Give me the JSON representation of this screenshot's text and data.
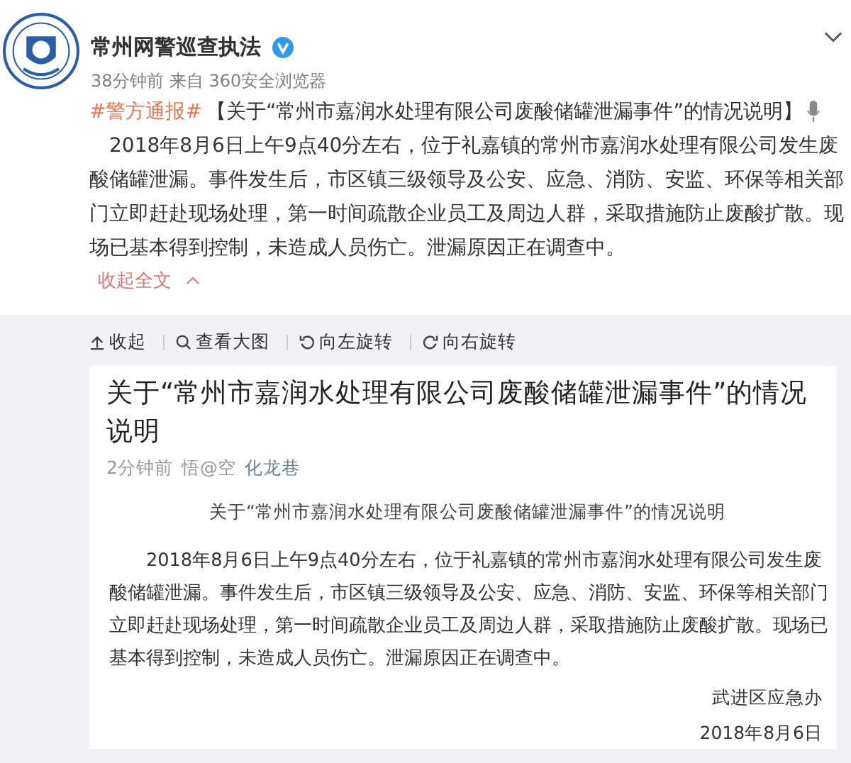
{
  "post": {
    "author": "常州网警巡查执法",
    "verified": true,
    "time": "38分钟前",
    "source_prefix": "来自",
    "source": "360安全浏览器",
    "hashtag": "#警方通报#",
    "headline": "【关于“常州市嘉润水处理有限公司废酸储罐泄漏事件”的情况说明】",
    "body": "2018年8月6日上午9点40分左右，位于礼嘉镇的常州市嘉润水处理有限公司发生废酸储罐泄漏。事件发生后，市区镇三级领导及公安、应急、消防、安监、环保等相关部门立即赶赴现场处理，第一时间疏散企业员工及周边人群，采取措施防止废酸扩散。现场已基本得到控制，未造成人员伤亡。泄漏原因正在调查中。",
    "collapse": "收起全文"
  },
  "image_toolbar": [
    {
      "kind": "collapse",
      "label": "收起"
    },
    {
      "kind": "zoom",
      "label": "查看大图"
    },
    {
      "kind": "rotate_left",
      "label": "向左旋转"
    },
    {
      "kind": "rotate_right",
      "label": "向右旋转"
    }
  ],
  "article": {
    "title": "关于“常州市嘉润水处理有限公司废酸储罐泄漏事件”的情况说明",
    "time": "2分钟前",
    "author": "悟@空",
    "location": "化龙巷",
    "doc_title": "关于“常州市嘉润水处理有限公司废酸储罐泄漏事件”的情况说明",
    "doc_body": "2018年8月6日上午9点40分左右，位于礼嘉镇的常州市嘉润水处理有限公司发生废酸储罐泄漏。事件发生后，市区镇三级领导及公安、应急、消防、安监、环保等相关部门立即赶赴现场处理，第一时间疏散企业员工及周边人群，采取措施防止废酸扩散。现场已基本得到控制，未造成人员伤亡。泄漏原因正在调查中。",
    "signature": "武进区应急办",
    "date": "2018年8月6日"
  }
}
